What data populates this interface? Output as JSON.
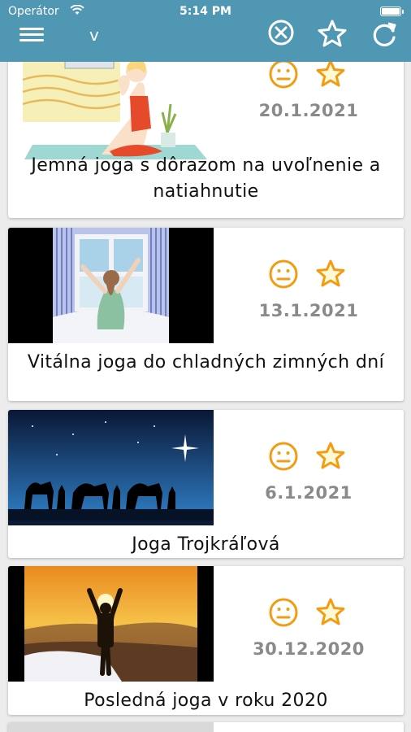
{
  "status_bar": {
    "carrier": "Operátor",
    "time": "5:14 PM"
  },
  "toolbar": {
    "search_value": "v",
    "icons": [
      "menu-icon",
      "clear-search-icon",
      "favorites-star-icon",
      "refresh-icon"
    ]
  },
  "colors": {
    "header": "#4f97b3",
    "accent": "#f39c12",
    "date": "#8a8a8a"
  },
  "items": [
    {
      "title": "Jemná joga s dôrazom na uvoľnenie a natiahnutie",
      "date": "20.1.2021",
      "icons": [
        "neutral-face-icon",
        "star-icon"
      ]
    },
    {
      "title": "Vitálna joga do chladných zimných dní",
      "date": "13.1.2021",
      "icons": [
        "neutral-face-icon",
        "star-icon"
      ]
    },
    {
      "title": "Joga Trojkráľová",
      "date": "6.1.2021",
      "icons": [
        "neutral-face-icon",
        "star-icon"
      ]
    },
    {
      "title": "Posledná joga v roku 2020",
      "date": "30.12.2020",
      "icons": [
        "neutral-face-icon",
        "star-icon"
      ]
    }
  ]
}
